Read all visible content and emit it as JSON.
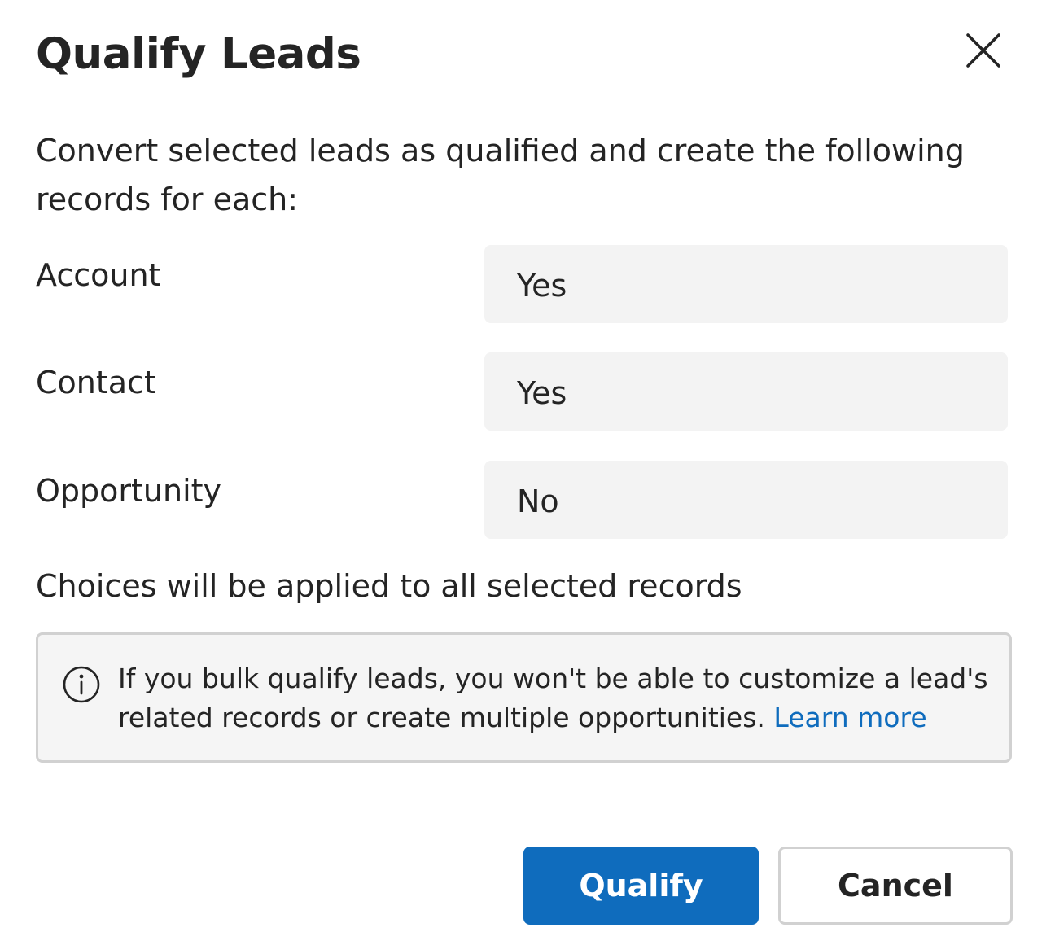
{
  "dialog": {
    "title": "Qualify Leads",
    "close_icon": "close-icon",
    "description": "Convert selected leads as qualified and create the following records for each:",
    "rows": [
      {
        "label": "Account",
        "value": "Yes"
      },
      {
        "label": "Contact",
        "value": "Yes"
      },
      {
        "label": "Opportunity",
        "value": "No"
      }
    ],
    "choices_note": "Choices will be applied to all selected records",
    "info": {
      "icon": "info-icon",
      "text": "If you bulk qualify leads, you won't be able to customize a lead's related records or create multiple opportunities.",
      "link": "Learn more"
    },
    "buttons": {
      "qualify": "Qualify",
      "cancel": "Cancel"
    }
  },
  "colors": {
    "primary": "#0f6cbd",
    "field_background": "#f3f3f3",
    "info_background": "#f5f5f5",
    "border": "#d1d1d1",
    "text": "#242424"
  }
}
